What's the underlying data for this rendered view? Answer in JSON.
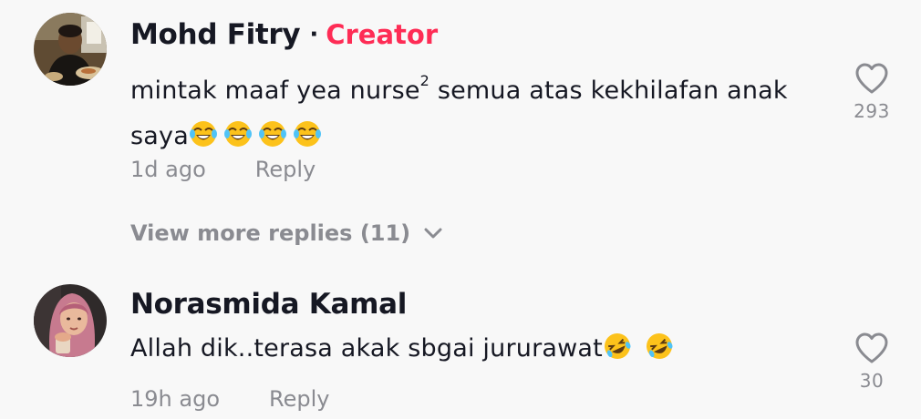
{
  "comments": [
    {
      "username": "Mohd Fitry",
      "separator": "·",
      "badge": "Creator",
      "text_main": "mintak maaf yea nurse",
      "text_sup": "2",
      "text_rest": " semua atas kekhilafan anak",
      "text_line2": "saya",
      "emojis": [
        "face-with-tears-of-joy",
        "face-with-tears-of-joy",
        "face-with-tears-of-joy",
        "face-with-tears-of-joy"
      ],
      "time": "1d ago",
      "reply_label": "Reply",
      "like_count": "293"
    },
    {
      "username": "Norasmida Kamal",
      "text": "Allah dik..terasa akak sbgai jururawat",
      "emojis": [
        "rolling-on-the-floor-laughing",
        "rolling-on-the-floor-laughing"
      ],
      "time": "19h ago",
      "reply_label": "Reply",
      "like_count": "30"
    }
  ],
  "view_more_replies": "View more replies (11)",
  "colors": {
    "background": "#f8f8f8",
    "text_primary": "#161823",
    "text_secondary": "#8a8b91",
    "creator_accent": "#fe2c55"
  }
}
